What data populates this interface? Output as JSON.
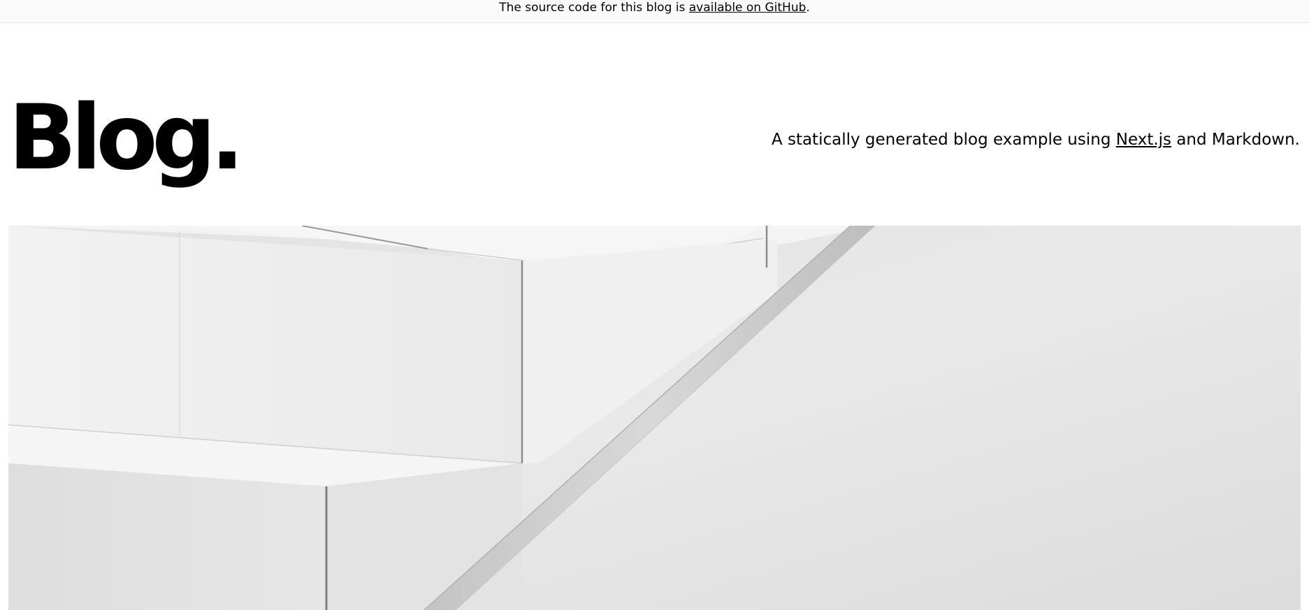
{
  "banner": {
    "text_before": "The source code for this blog is ",
    "link_text": "available on GitHub",
    "text_after": "."
  },
  "header": {
    "title": "Blog.",
    "tagline_before": "A statically generated blog example using ",
    "tagline_link": "Next.js",
    "tagline_after": " and Markdown."
  },
  "hero": {
    "image_subject": "abstract white architecture staircase"
  }
}
